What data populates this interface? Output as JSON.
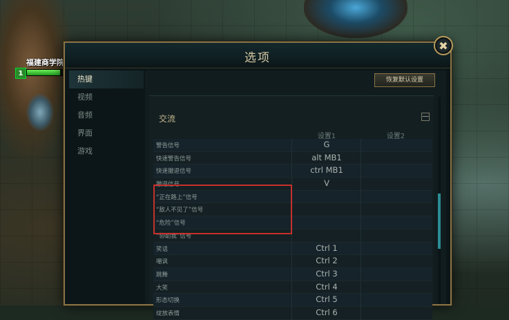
{
  "game": {
    "unit_name": "福建商学院",
    "level": "1",
    "hp_fraction": 0.85
  },
  "dialog": {
    "title": "选项",
    "close_label": "✖",
    "reset_button": "恢复默认设置"
  },
  "sidebar": {
    "items": [
      {
        "label": "热键",
        "active": true
      },
      {
        "label": "视频",
        "active": false
      },
      {
        "label": "音频",
        "active": false
      },
      {
        "label": "界面",
        "active": false
      },
      {
        "label": "游戏",
        "active": false
      }
    ]
  },
  "section": {
    "title": "交流",
    "collapse_label": "—",
    "columns": [
      "设置1",
      "设置2"
    ],
    "rows": [
      {
        "label": "警告信号",
        "key1": "G",
        "key2": ""
      },
      {
        "label": "快速警告信号",
        "key1": "alt MB1",
        "key2": ""
      },
      {
        "label": "快速撤退信号",
        "key1": "ctrl MB1",
        "key2": ""
      },
      {
        "label": "撤退信号",
        "key1": "V",
        "key2": ""
      },
      {
        "label": "“正在路上”信号",
        "key1": "",
        "key2": ""
      },
      {
        "label": "“敌人不见了”信号",
        "key1": "",
        "key2": ""
      },
      {
        "label": "“危险”信号",
        "key1": "",
        "key2": ""
      },
      {
        "label": "“协助我”信号",
        "key1": "",
        "key2": ""
      },
      {
        "label": "笑话",
        "key1": "Ctrl 1",
        "key2": ""
      },
      {
        "label": "嘲讽",
        "key1": "Ctrl 2",
        "key2": ""
      },
      {
        "label": "跳舞",
        "key1": "Ctrl 3",
        "key2": ""
      },
      {
        "label": "大笑",
        "key1": "Ctrl 4",
        "key2": ""
      },
      {
        "label": "形态切换",
        "key1": "Ctrl 5",
        "key2": ""
      },
      {
        "label": "绽放表情",
        "key1": "Ctrl 6",
        "key2": ""
      }
    ]
  },
  "colors": {
    "accent_gold": "#8a7446",
    "highlight_red": "#c8312b",
    "scroll_teal": "#2c8c96"
  }
}
